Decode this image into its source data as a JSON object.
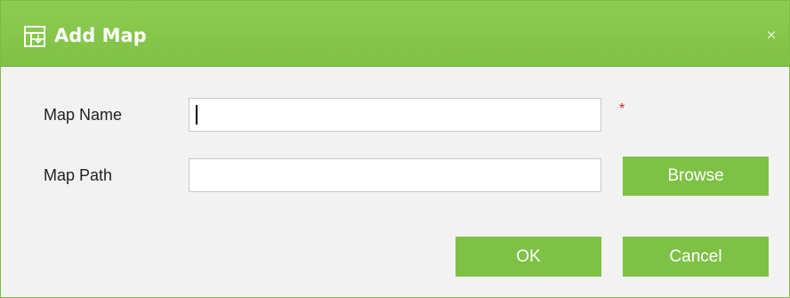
{
  "dialog": {
    "title": "Add Map",
    "title_icon": "map-icon",
    "close_label": "×",
    "accent_color": "#7ec246"
  },
  "form": {
    "map_name": {
      "label": "Map Name",
      "value": "",
      "required_mark": "*"
    },
    "map_path": {
      "label": "Map Path",
      "value": ""
    }
  },
  "buttons": {
    "browse": "Browse",
    "ok": "OK",
    "cancel": "Cancel"
  }
}
